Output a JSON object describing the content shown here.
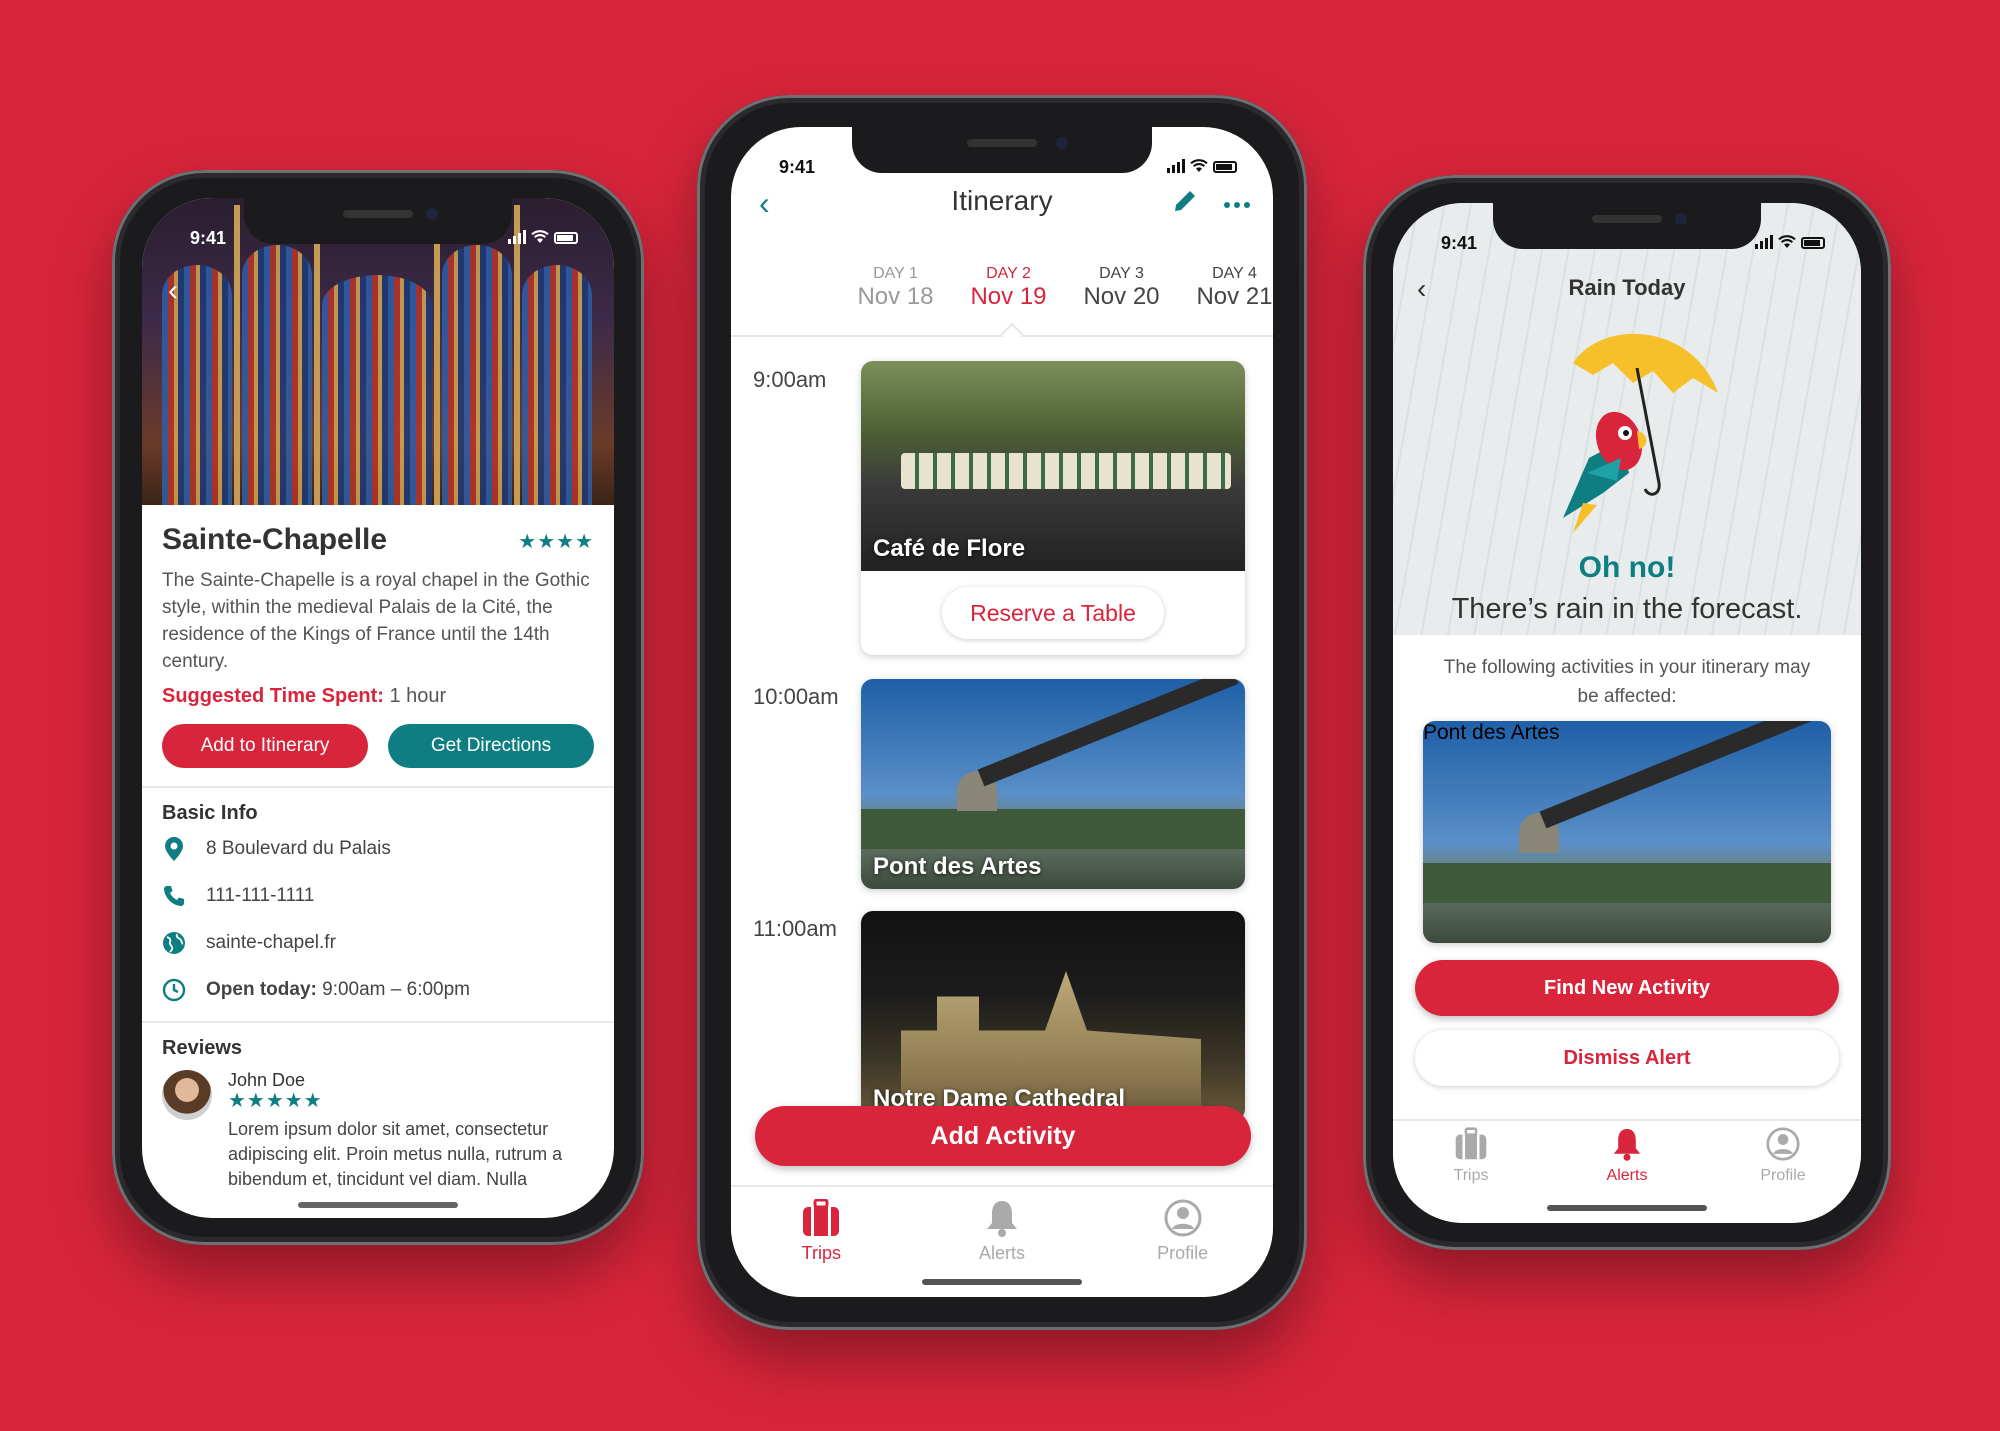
{
  "status": {
    "time": "9:41"
  },
  "place": {
    "title": "Sainte-Chapelle",
    "stars": "★★★★",
    "description": "The Sainte-Chapelle is a royal chapel in the Gothic style, within the medieval Palais de la Cité, the residence of the Kings of France until the 14th century.",
    "suggested_label": "Suggested Time Spent:",
    "suggested_value": "1 hour",
    "add_button": "Add to Itinerary",
    "directions_button": "Get Directions",
    "basic_info_title": "Basic Info",
    "address": "8 Boulevard du Palais",
    "phone": "111-111-1111",
    "website": "sainte-chapel.fr",
    "open_label": "Open today:",
    "open_hours": "9:00am – 6:00pm",
    "reviews_title": "Reviews",
    "review": {
      "name": "John Doe",
      "stars": "★★★★★",
      "text": "Lorem ipsum dolor sit amet, consectetur adipiscing elit. Proin metus nulla, rutrum a bibendum et, tincidunt vel diam. Nulla"
    }
  },
  "itinerary": {
    "title": "Itinerary",
    "days": [
      {
        "label": "DAY 1",
        "date": "Nov 18"
      },
      {
        "label": "DAY 2",
        "date": "Nov 19"
      },
      {
        "label": "DAY 3",
        "date": "Nov 20"
      },
      {
        "label": "DAY 4",
        "date": "Nov 21"
      }
    ],
    "selected_day": 1,
    "slots": [
      {
        "time": "9:00am",
        "name": "Café de Flore",
        "action": "Reserve a Table"
      },
      {
        "time": "10:00am",
        "name": "Pont des Artes"
      },
      {
        "time": "11:00am",
        "name": "Notre Dame Cathedral"
      }
    ],
    "add_activity": "Add Activity"
  },
  "alert": {
    "title": "Rain Today",
    "headline": "Oh no!",
    "message": "There’s rain in the forecast.",
    "affected_text": "The following activities in your itinerary may be affected:",
    "activity_name": "Pont des Artes",
    "find_button": "Find New Activity",
    "dismiss_button": "Dismiss Alert"
  },
  "tabs": {
    "trips": "Trips",
    "alerts": "Alerts",
    "profile": "Profile"
  },
  "colors": {
    "brand_red": "#d9253b",
    "teal": "#0e7e82"
  }
}
